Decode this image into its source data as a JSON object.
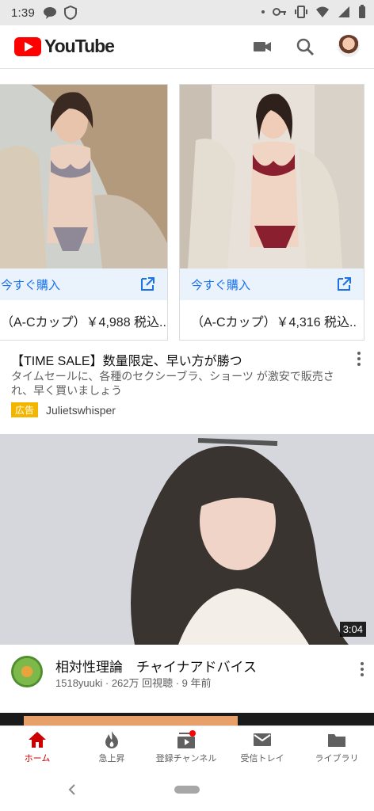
{
  "status_bar": {
    "time": "1:39"
  },
  "header": {
    "logo_text": "YouTube"
  },
  "ad_carousel": {
    "cards": [
      {
        "buy_label": "今すぐ購入",
        "price_text": "（A-Cカップ）￥4,988 税込.."
      },
      {
        "buy_label": "今すぐ購入",
        "price_text": "（A-Cカップ）￥4,316 税込.."
      }
    ]
  },
  "ad": {
    "title": "【TIME SALE】数量限定、早い方が勝つ",
    "description": "タイムセールに、各種のセクシーブラ、ショーツ が激安で販売され、早く買いましょう",
    "badge": "広告",
    "advertiser": "Julietswhisper"
  },
  "video": {
    "duration": "3:04",
    "title": "相対性理論　チャイナアドバイス",
    "meta": "1518yuuki · 262万 回視聴 · 9 年前"
  },
  "bottom_nav": {
    "items": [
      {
        "label": "ホーム",
        "icon": "home-icon",
        "active": true
      },
      {
        "label": "急上昇",
        "icon": "trending-icon",
        "active": false
      },
      {
        "label": "登録チャンネル",
        "icon": "subscriptions-icon",
        "active": false
      },
      {
        "label": "受信トレイ",
        "icon": "inbox-icon",
        "active": false
      },
      {
        "label": "ライブラリ",
        "icon": "library-icon",
        "active": false
      }
    ]
  },
  "colors": {
    "brand_red": "#ff0000",
    "link_blue": "#1a73e8",
    "ad_badge": "#f2b600",
    "active_nav": "#cc0000"
  }
}
